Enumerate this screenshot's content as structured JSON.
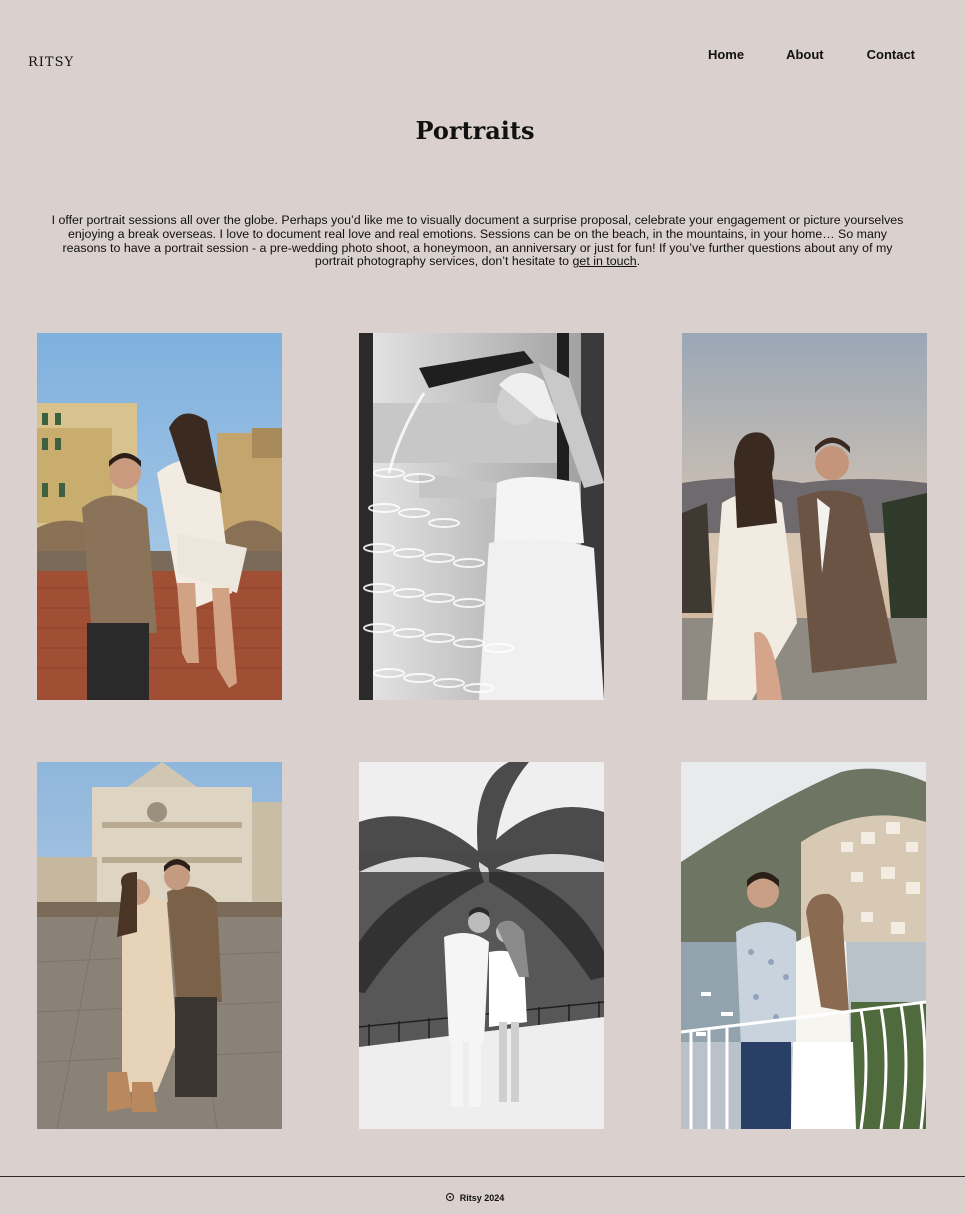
{
  "header": {
    "logo": "RITSY",
    "nav": [
      "Home",
      "About",
      "Contact"
    ]
  },
  "main": {
    "title": "Portraits",
    "intro_text": "I offer portrait sessions all over the globe. Perhaps you’d like me to visually document a surprise proposal, celebrate your engagement or picture yourselves enjoying a break overseas. I love to document real love and real emotions. Sessions can be on the beach, in the mountains, in your home… So many reasons to have a portrait session - a pre-wedding photo shoot, a honeymoon, an anniversary or just for fun! If you’ve further questions about any of my portrait photography services, don’t hesitate to ",
    "intro_link": "get in touch",
    "intro_end": "."
  },
  "footer": {
    "text": "Ritsy 2024"
  }
}
